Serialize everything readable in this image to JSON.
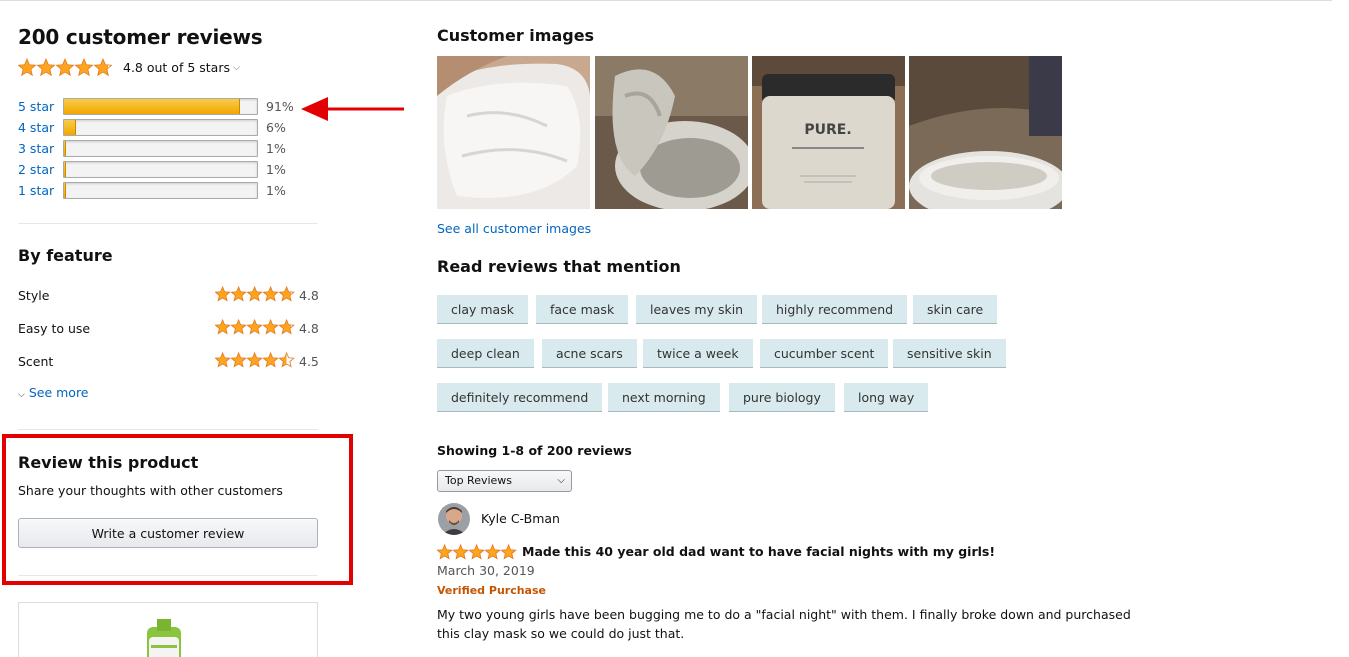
{
  "summary": {
    "title": "200 customer reviews",
    "rating_text": "4.8 out of 5 stars",
    "rating": 4.8
  },
  "histogram": [
    {
      "label": "5 star",
      "percent_text": "91%",
      "percent": 91
    },
    {
      "label": "4 star",
      "percent_text": "6%",
      "percent": 6
    },
    {
      "label": "3 star",
      "percent_text": "1%",
      "percent": 1
    },
    {
      "label": "2 star",
      "percent_text": "1%",
      "percent": 1
    },
    {
      "label": "1 star",
      "percent_text": "1%",
      "percent": 1
    }
  ],
  "by_feature": {
    "title": "By feature",
    "items": [
      {
        "name": "Style",
        "value": "4.8",
        "rating": 4.8
      },
      {
        "name": "Easy to use",
        "value": "4.8",
        "rating": 4.8
      },
      {
        "name": "Scent",
        "value": "4.5",
        "rating": 4.5
      }
    ],
    "see_more": "See more"
  },
  "review_product": {
    "title": "Review this product",
    "subtitle": "Share your thoughts with other customers",
    "button": "Write a customer review"
  },
  "customer_images": {
    "title": "Customer images",
    "see_all": "See all customer images",
    "thumb_brand": "PURE."
  },
  "mentions": {
    "title": "Read reviews that mention",
    "chips": [
      "clay mask",
      "face mask",
      "leaves my skin",
      "highly recommend",
      "skin care",
      "deep clean",
      "acne scars",
      "twice a week",
      "cucumber scent",
      "sensitive skin",
      "definitely recommend",
      "next morning",
      "pure biology",
      "long way"
    ]
  },
  "reviews": {
    "showing": "Showing 1-8 of 200 reviews",
    "sort_value": "Top Reviews",
    "first": {
      "author": "Kyle C-Bman",
      "rating": 5,
      "title": "Made this 40 year old dad want to have facial nights with my girls!",
      "date": "March 30, 2019",
      "verified": "Verified Purchase",
      "body": "My two young girls have been bugging me to do a \"facial night\" with them. I finally broke down and purchased this clay mask so we could do just that."
    }
  },
  "colors": {
    "star": "#ffa41c",
    "link": "#0066c0",
    "highlight_box": "#e20000",
    "chip_bg": "#d8eaed",
    "verified": "#c45500"
  }
}
